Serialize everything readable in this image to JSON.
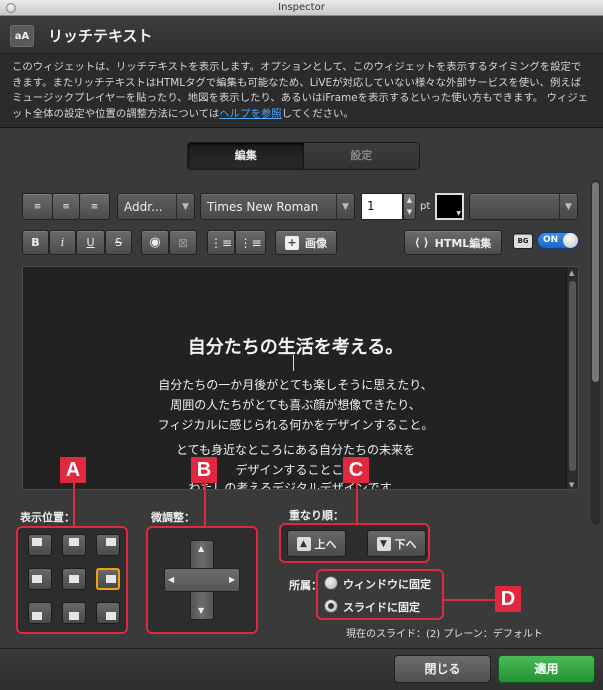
{
  "window": {
    "title": "Inspector"
  },
  "header": {
    "icon_label": "aA",
    "title": "リッチテキスト"
  },
  "description": {
    "text_before_link": "このウィジェットは、リッチテキストを表示します。オプションとして、このウィジェットを表示するタイミングを設定できます。またリッチテキストはHTMLタグで編集も可能なため、LiVEが対応していない様々な外部サービスを使い、例えばミュージックプレイヤーを貼ったり、地図を表示したり、あるいはiFrameを表示するといった使い方もできます。 ウィジェット全体の設定や位置の調整方法については",
    "link": "ヘルプを参照",
    "text_after_link": "してください。"
  },
  "tabs": [
    {
      "label": "編集",
      "selected": true
    },
    {
      "label": "設定",
      "selected": false
    }
  ],
  "toolbar": {
    "paragraph_style": "Addr...",
    "font_family": "Times New Roman",
    "font_size": "1",
    "unit": "pt",
    "text_color": "#000000",
    "extra_select": "",
    "bold": "B",
    "italic": "i",
    "underline": "U",
    "strike": "S",
    "image_label": "画像",
    "html_edit_label": "HTML編集",
    "bg_label": "BG",
    "toggle_label": "ON"
  },
  "editor": {
    "heading": "自分たちの生活を考える。",
    "lines": [
      "自分たちの一か月後がとても楽しそうに思えたり、",
      "周囲の人たちがとても喜ぶ顔が想像できたり、",
      "フィジカルに感じられる何かをデザインすること。",
      "",
      "とても身近なところにある自分たちの未来を",
      "デザインすることこそ",
      "わたしの考えるデジタルデザインです。"
    ]
  },
  "position": {
    "label": "表示位置：",
    "selected_index": 5
  },
  "nudge": {
    "label": "微調整："
  },
  "order": {
    "label": "重なり順：",
    "up": "上へ",
    "down": "下へ"
  },
  "belong": {
    "label": "所属：",
    "options": [
      {
        "label": "ウィンドウに固定",
        "selected": false
      },
      {
        "label": "スライドに固定",
        "selected": true
      }
    ],
    "current_slide": "現在のスライド：(2) プレーン：デフォルト"
  },
  "badges": {
    "a": "A",
    "b": "B",
    "c": "C",
    "d": "D"
  },
  "footer": {
    "close": "閉じる",
    "apply": "適用"
  },
  "colors": {
    "accent_red": "#e0293f",
    "apply_green": "#2fa33f",
    "toggle_blue": "#2a7ad8",
    "selected_orange": "#f2a10a"
  }
}
